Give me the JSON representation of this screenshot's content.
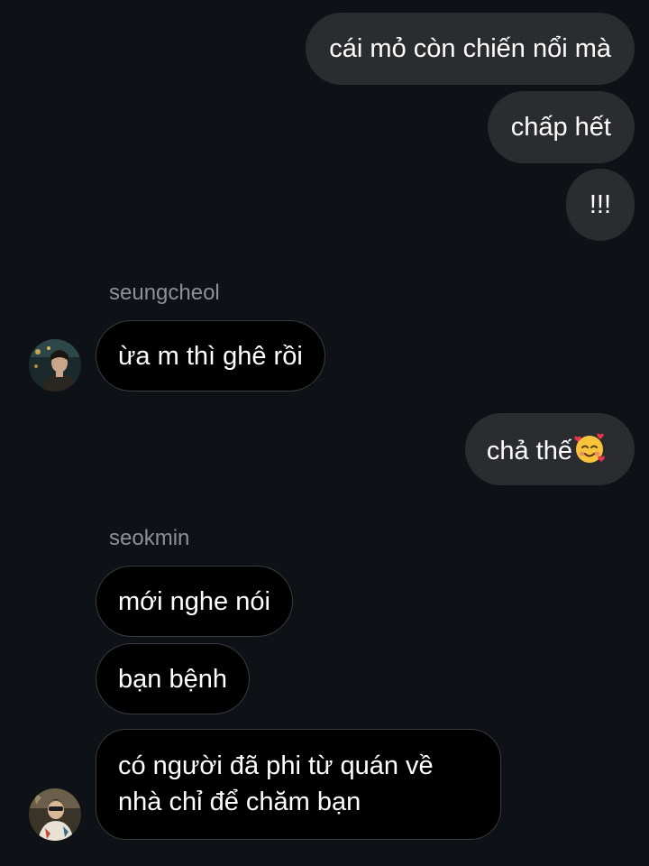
{
  "thread": {
    "messages_top_sent": [
      {
        "text": "cái mỏ còn chiến nổi mà"
      },
      {
        "text": "chấp hết"
      },
      {
        "text": "!!!"
      }
    ],
    "group1": {
      "sender": "seungcheol",
      "avatar_icon": "profile-photo",
      "message": "ừa m thì ghê rồi"
    },
    "sent_mid": {
      "text": "chả thế",
      "emoji": "smiling-face-with-hearts"
    },
    "group2": {
      "sender": "seokmin",
      "avatar_icon": "profile-photo",
      "messages": [
        {
          "text": "mới nghe nói"
        },
        {
          "text": "bạn bệnh"
        },
        {
          "text": "có người đã phi từ quán về nhà chỉ để chăm bạn"
        }
      ]
    }
  },
  "colors": {
    "background": "#0e1217",
    "sent_bubble": "#2b2c2f",
    "received_bubble": "#000000",
    "received_border": "#3a3b3e",
    "sender_name": "#8e9096"
  }
}
